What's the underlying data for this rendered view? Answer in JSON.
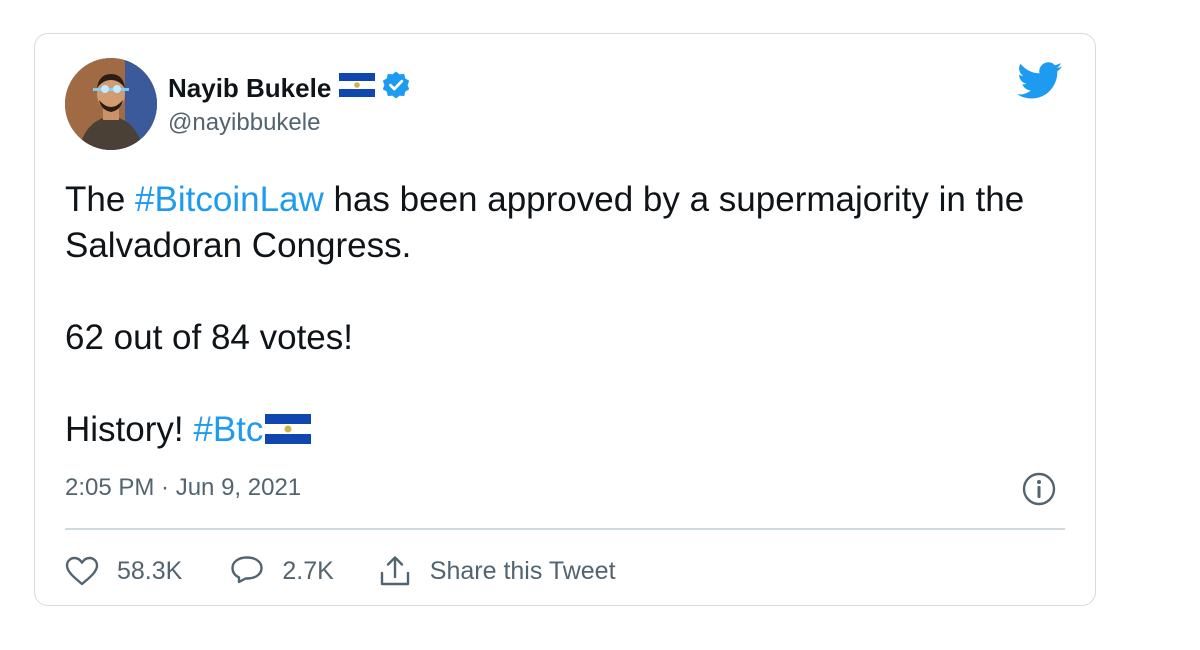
{
  "author": {
    "name": "Nayib Bukele",
    "handle": "@nayibbukele",
    "flag_icon": "el-salvador-flag-icon",
    "verified_icon": "verified-badge-icon"
  },
  "tweet": {
    "paragraph1": {
      "prefix": "The ",
      "hashtag": "#BitcoinLaw",
      "suffix": " has been approved by a supermajority in the Salvadoran Congress."
    },
    "paragraph2": "62 out of 84 votes!",
    "paragraph3": {
      "prefix": "History! ",
      "hashtag": "#Btc"
    },
    "timestamp": "2:05 PM · Jun 9, 2021"
  },
  "actions": {
    "like_count": "58.3K",
    "reply_count": "2.7K",
    "share_label": "Share this Tweet"
  },
  "colors": {
    "link": "#1d9bf0",
    "text": "#0f1419",
    "secondary": "#536471",
    "twitter_blue": "#1d9bf0",
    "flag_blue": "#0f47af"
  }
}
